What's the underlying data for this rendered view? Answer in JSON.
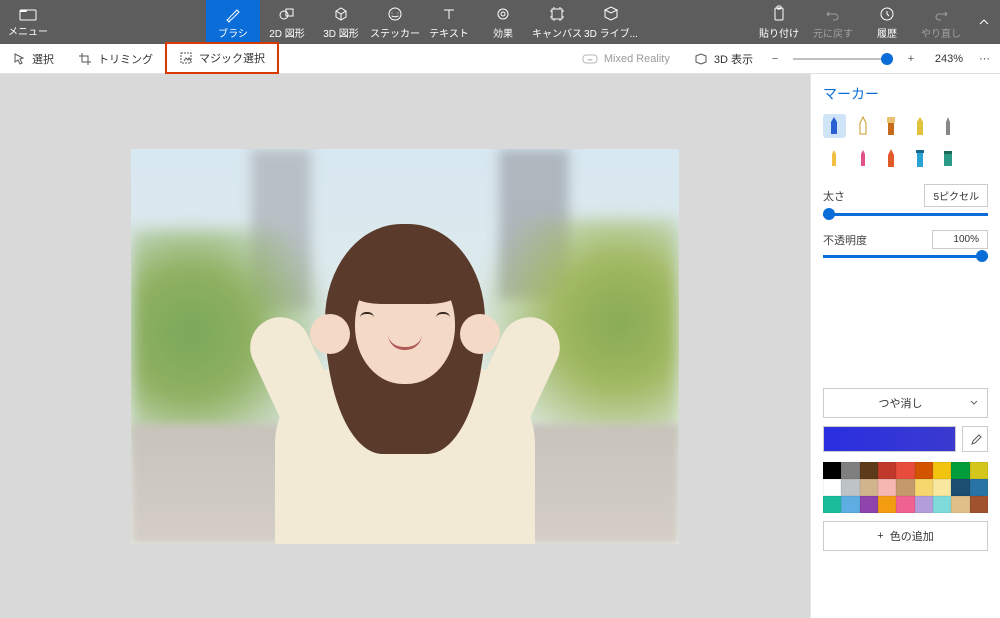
{
  "topbar": {
    "menu": "メニュー",
    "tabs": [
      {
        "label": "ブラシ",
        "active": true
      },
      {
        "label": "2D 図形"
      },
      {
        "label": "3D 図形"
      },
      {
        "label": "ステッカー"
      },
      {
        "label": "テキスト"
      },
      {
        "label": "効果"
      },
      {
        "label": "キャンバス"
      },
      {
        "label": "3D ライブ..."
      }
    ],
    "right": [
      {
        "label": "貼り付け"
      },
      {
        "label": "元に戻す",
        "disabled": true
      },
      {
        "label": "履歴"
      },
      {
        "label": "やり直し",
        "disabled": true
      }
    ]
  },
  "subbar": {
    "select": "選択",
    "crop": "トリミング",
    "magic": "マジック選択",
    "mixed": "Mixed Reality",
    "view3d": "3D 表示",
    "zoom": "243%"
  },
  "panel": {
    "title": "マーカー",
    "thickness_label": "太さ",
    "thickness_value": "5ピクセル",
    "opacity_label": "不透明度",
    "opacity_value": "100%",
    "finish": "つや消し",
    "add_color": "色の追加",
    "swatches": [
      "#000000",
      "#7f7f7f",
      "#5c3a1a",
      "#c0392b",
      "#e74c3c",
      "#d35400",
      "#f1c40f",
      "#009e3a",
      "#d4c61a",
      "#ffffff",
      "#bdc3c7",
      "#d2b48c",
      "#f5b7b1",
      "#c49a6c",
      "#f5d76e",
      "#f9e79f",
      "#1b4f72",
      "#2874a6",
      "#1abc9c",
      "#5dade2",
      "#8e44ad",
      "#f39c12",
      "#f06292",
      "#b39ddb",
      "#7fdbda",
      "#e0c088",
      "#a0522d"
    ]
  }
}
